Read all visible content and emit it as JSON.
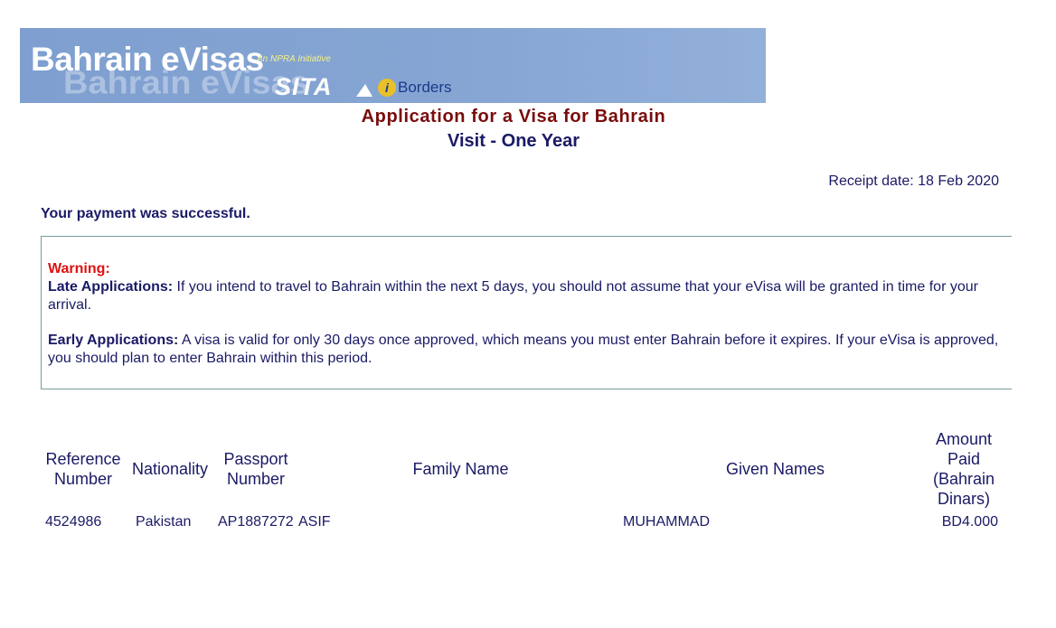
{
  "banner": {
    "title": "Bahrain eVisas",
    "shadow_text": "Bahrain eVisas",
    "tagline": "An NPRA Initiative",
    "sita_logo": "SITA",
    "iborders_icon": "i",
    "iborders_text": "Borders"
  },
  "page": {
    "title": "Application for a Visa for Bahrain",
    "subtitle": "Visit - One Year",
    "receipt": "Receipt date: 18 Feb 2020",
    "success_message": "Your payment was successful."
  },
  "warning": {
    "label": "Warning:",
    "late_title": "Late Applications:",
    "late_text": " If you intend to travel to Bahrain within the next 5 days, you should not assume that your eVisa will be granted in time for your arrival.",
    "early_title": "Early Applications:",
    "early_text": " A visa is valid for only 30 days once approved, which means you must enter Bahrain before it expires. If your eVisa is approved, you should plan to enter Bahrain within this period."
  },
  "table": {
    "headers": {
      "reference": "Reference Number",
      "nationality": "Nationality",
      "passport": "Passport Number",
      "family": "Family Name",
      "given": "Given Names",
      "amount": "Amount Paid (Bahrain Dinars)"
    },
    "rows": [
      {
        "reference": "4524986",
        "nationality": "Pakistan",
        "passport": "AP1887272",
        "family": "ASIF",
        "given": "MUHAMMAD",
        "amount": "BD4.000"
      }
    ]
  },
  "colors": {
    "banner": "#86a5d3",
    "title": "#7a0c0c",
    "text": "#1a1a66",
    "warning": "#e01010"
  }
}
